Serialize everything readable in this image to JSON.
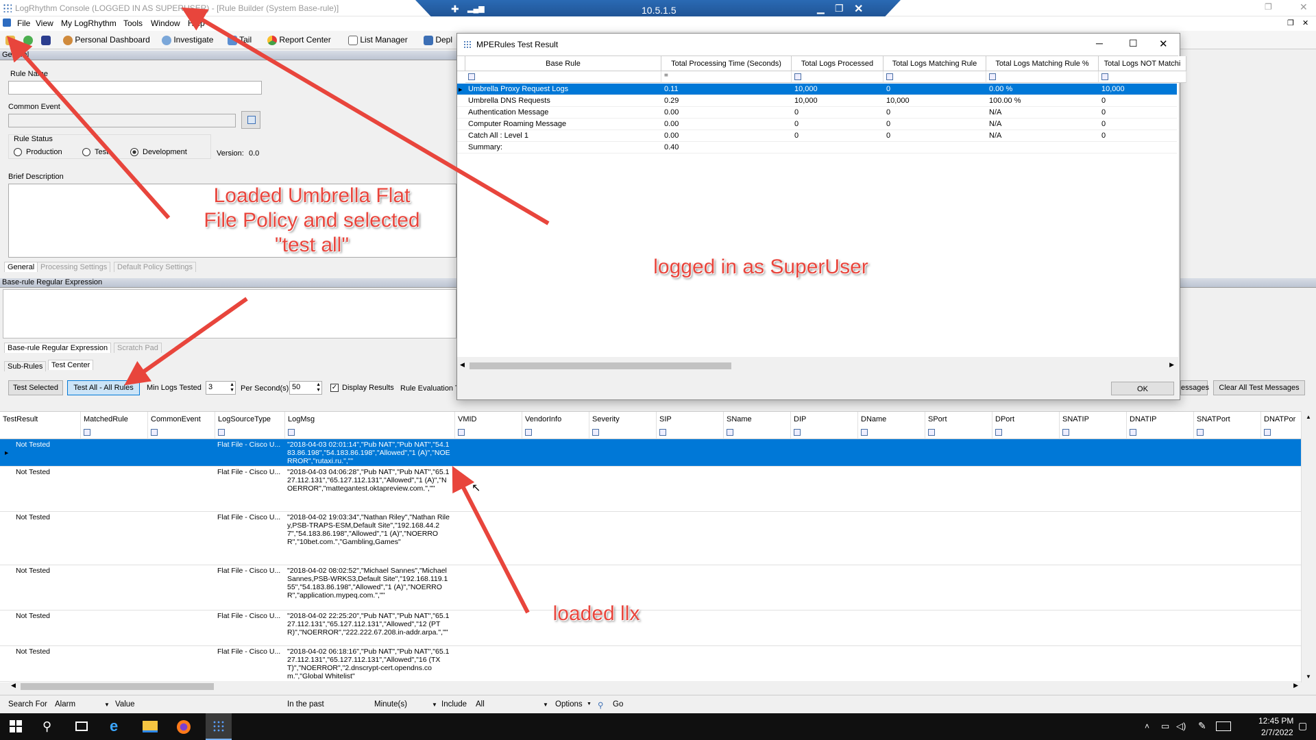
{
  "window": {
    "title": "LogRhythm Console  (LOGGED IN AS SUPERUSER) - [Rule Builder (System Base-rule)]"
  },
  "rdp": {
    "ip": "10.5.1.5"
  },
  "menu": [
    "File",
    "View",
    "My LogRhythm",
    "Tools",
    "Window",
    "Help"
  ],
  "toolbar": {
    "personal_dashboard": "Personal Dashboard",
    "investigate": "Investigate",
    "tail": "Tail",
    "report_center": "Report Center",
    "list_manager": "List Manager",
    "deploy": "Depl"
  },
  "general": {
    "header": "General",
    "rule_name_label": "Rule Name",
    "common_event_label": "Common Event",
    "rule_status_label": "Rule Status",
    "status_production": "Production",
    "status_test": "Test",
    "status_development": "Development",
    "version_label": "Version:",
    "version_value": "0.0",
    "brief_description_label": "Brief Description",
    "tabs": [
      "General",
      "Processing Settings",
      "Default Policy Settings"
    ]
  },
  "regex": {
    "header": "Base-rule Regular Expression",
    "tabs": [
      "Base-rule Regular Expression",
      "Scratch Pad"
    ]
  },
  "subtabs": [
    "Sub-Rules",
    "Test Center"
  ],
  "test_center": {
    "test_selected": "Test Selected",
    "test_all": "Test All - All Rules",
    "min_logs_label": "Min Logs Tested",
    "min_logs_value": "3",
    "per_second_label": "Per Second(s)",
    "per_second_value": "50",
    "display_results": "Display Results",
    "rule_evaluation": "Rule Evaluation T",
    "messages": "essages",
    "clear_all": "Clear All Test Messages"
  },
  "grid": {
    "columns": [
      "TestResult",
      "MatchedRule",
      "CommonEvent",
      "LogSourceType",
      "LogMsg",
      "VMID",
      "VendorInfo",
      "Severity",
      "SIP",
      "SName",
      "DIP",
      "DName",
      "SPort",
      "DPort",
      "SNATIP",
      "DNATIP",
      "SNATPort",
      "DNATPor"
    ],
    "rows": [
      {
        "result": "Not Tested",
        "lst": "Flat File - Cisco U...",
        "msg": "\"2018-04-03 02:01:14\",\"Pub NAT\",\"Pub NAT\",\"54.183.86.198\",\"54.183.86.198\",\"Allowed\",\"1 (A)\",\"NOERROR\",\"rutaxi.ru.\",\"\""
      },
      {
        "result": "Not Tested",
        "lst": "Flat File - Cisco U...",
        "msg": "\"2018-04-03 04:06:28\",\"Pub NAT\",\"Pub NAT\",\"65.127.112.131\",\"65.127.112.131\",\"Allowed\",\"1 (A)\",\"NOERROR\",\"mattegantest.oktapreview.com.\",\"\""
      },
      {
        "result": "Not Tested",
        "lst": "Flat File - Cisco U...",
        "msg": "\"2018-04-02 19:03:34\",\"Nathan Riley\",\"Nathan Riley,PSB-TRAPS-ESM,Default Site\",\"192.168.44.27\",\"54.183.86.198\",\"Allowed\",\"1 (A)\",\"NOERROR\",\"10bet.com.\",\"Gambling,Games\""
      },
      {
        "result": "Not Tested",
        "lst": "Flat File - Cisco U...",
        "msg": "\"2018-04-02 08:02:52\",\"Michael Sannes\",\"Michael Sannes,PSB-WRKS3,Default Site\",\"192.168.119.155\",\"54.183.86.198\",\"Allowed\",\"1 (A)\",\"NOERROR\",\"application.mypeq.com.\",\"\""
      },
      {
        "result": "Not Tested",
        "lst": "Flat File - Cisco U...",
        "msg": "\"2018-04-02 22:25:20\",\"Pub NAT\",\"Pub NAT\",\"65.127.112.131\",\"65.127.112.131\",\"Allowed\",\"12 (PTR)\",\"NOERROR\",\"222.222.67.208.in-addr.arpa.\",\"\""
      },
      {
        "result": "Not Tested",
        "lst": "Flat File - Cisco U...",
        "msg": "\"2018-04-02 06:18:16\",\"Pub NAT\",\"Pub NAT\",\"65.127.112.131\",\"65.127.112.131\",\"Allowed\",\"16 (TXT)\",\"NOERROR\",\"2.dnscrypt-cert.opendns.com.\",\"Global Whitelist\""
      }
    ]
  },
  "mpe": {
    "title": "MPERules Test Result",
    "columns": [
      "Base Rule",
      "Total Processing Time (Seconds)",
      "Total Logs Processed",
      "Total Logs Matching Rule",
      "Total Logs Matching Rule %",
      "Total Logs NOT Matchi"
    ],
    "filter_eq": "=",
    "rows": [
      [
        "Umbrella Proxy Request Logs",
        "0.11",
        "10,000",
        "0",
        "0.00 %",
        "10,000"
      ],
      [
        "Umbrella DNS Requests",
        "0.29",
        "10,000",
        "10,000",
        "100.00 %",
        "0"
      ],
      [
        "Authentication Message",
        "0.00",
        "0",
        "0",
        "N/A",
        "0"
      ],
      [
        "Computer Roaming Message",
        "0.00",
        "0",
        "0",
        "N/A",
        "0"
      ],
      [
        "Catch All : Level 1",
        "0.00",
        "0",
        "0",
        "N/A",
        "0"
      ],
      [
        "Summary:",
        "0.40",
        "",
        "",
        "",
        ""
      ]
    ],
    "ok": "OK"
  },
  "status": {
    "search_for": "Search For",
    "alarm": "Alarm",
    "value": "Value",
    "in_the_past": "In the past",
    "minutes": "Minute(s)",
    "include": "Include",
    "all": "All",
    "options": "Options",
    "go": "Go"
  },
  "taskbar": {
    "time": "12:45 PM",
    "date": "2/7/2022"
  },
  "annotations": {
    "a1": "Loaded Umbrella Flat File Policy and selected \"test all\"",
    "a2": "logged in as SuperUser",
    "a3": "loaded llx"
  },
  "colors": {
    "select": "#0078d7",
    "annotation": "#e8453c"
  }
}
